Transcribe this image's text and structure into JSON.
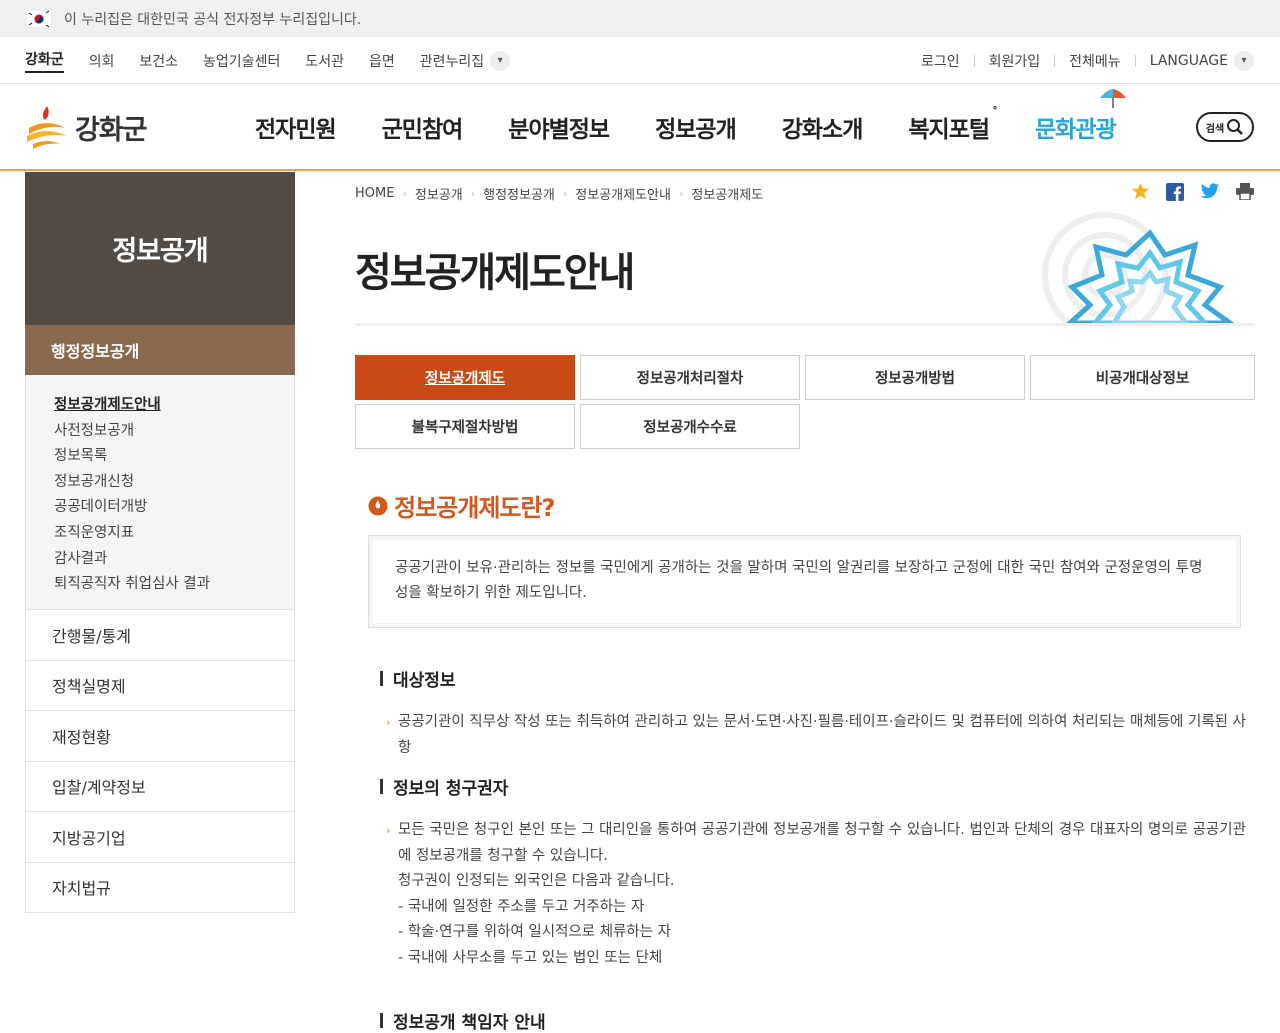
{
  "gov_banner": {
    "text": "이 누리집은 대한민국 공식 전자정부 누리집입니다."
  },
  "site_links": [
    "강화군",
    "의회",
    "보건소",
    "농업기술센터",
    "도서관",
    "읍면",
    "관련누리집"
  ],
  "user_links": [
    "로그인",
    "회원가입",
    "전체메뉴",
    "LANGUAGE"
  ],
  "logo": {
    "text": "강화군"
  },
  "gnb": [
    "전자민원",
    "군민참여",
    "분야별정보",
    "정보공개",
    "강화소개",
    "복지포털",
    "문화관광"
  ],
  "search": {
    "label": "검색"
  },
  "sidebar": {
    "title": "정보공개",
    "current": "행정정보공개",
    "sub_items": [
      "정보공개제도안내",
      "사전정보공개",
      "정보목록",
      "정보공개신청",
      "공공데이터개방",
      "조직운영지표",
      "감사결과",
      "퇴직공직자 취업심사 결과"
    ],
    "menu": [
      "간행물/통계",
      "정책실명제",
      "재정현황",
      "입찰/계약정보",
      "지방공기업",
      "자치법규"
    ]
  },
  "breadcrumb": [
    "HOME",
    "정보공개",
    "행정정보공개",
    "정보공개제도안내",
    "정보공개제도"
  ],
  "page_title": "정보공개제도안내",
  "tabs": [
    "정보공개제도",
    "정보공개처리절차",
    "정보공개방법",
    "비공개대상정보",
    "불복구제절차방법",
    "정보공개수수료"
  ],
  "section": {
    "heading": "정보공개제도란?",
    "definition": "공공기관이 보유·관리하는 정보를 국민에게 공개하는 것을 말하며 국민의 알권리를 보장하고 군정에 대한 국민 참여와 군정운영의 투명성을 확보하기 위한 제도입니다.",
    "target_heading": "대상정보",
    "target_text": "공공기관이 직무상 작성 또는 취득하여 관리하고 있는 문서·도면·사진·필름·테이프·슬라이드 및 컴퓨터에 의하여 처리되는 매체등에 기록된 사항",
    "claimant_heading": "정보의 청구권자",
    "claimant_text1": "모든 국민은 청구인 본인 또는 그 대리인을 통하여 공공기관에 정보공개를 청구할 수 있습니다. 법인과 단체의 경우 대표자의 명의로 공공기관에 정보공개를 청구할 수 있습니다.",
    "claimant_text2": "청구권이 인정되는 외국인은 다음과 같습니다.",
    "foreign_items": [
      "- 국내에 일정한 주소를 두고 거주하는 자",
      "- 학술·연구를 위하여 일시적으로 체류하는 자",
      "- 국내에 사무소를 두고 있는 법인 또는 단체"
    ],
    "next_heading": "정보공개 책임자 안내"
  }
}
